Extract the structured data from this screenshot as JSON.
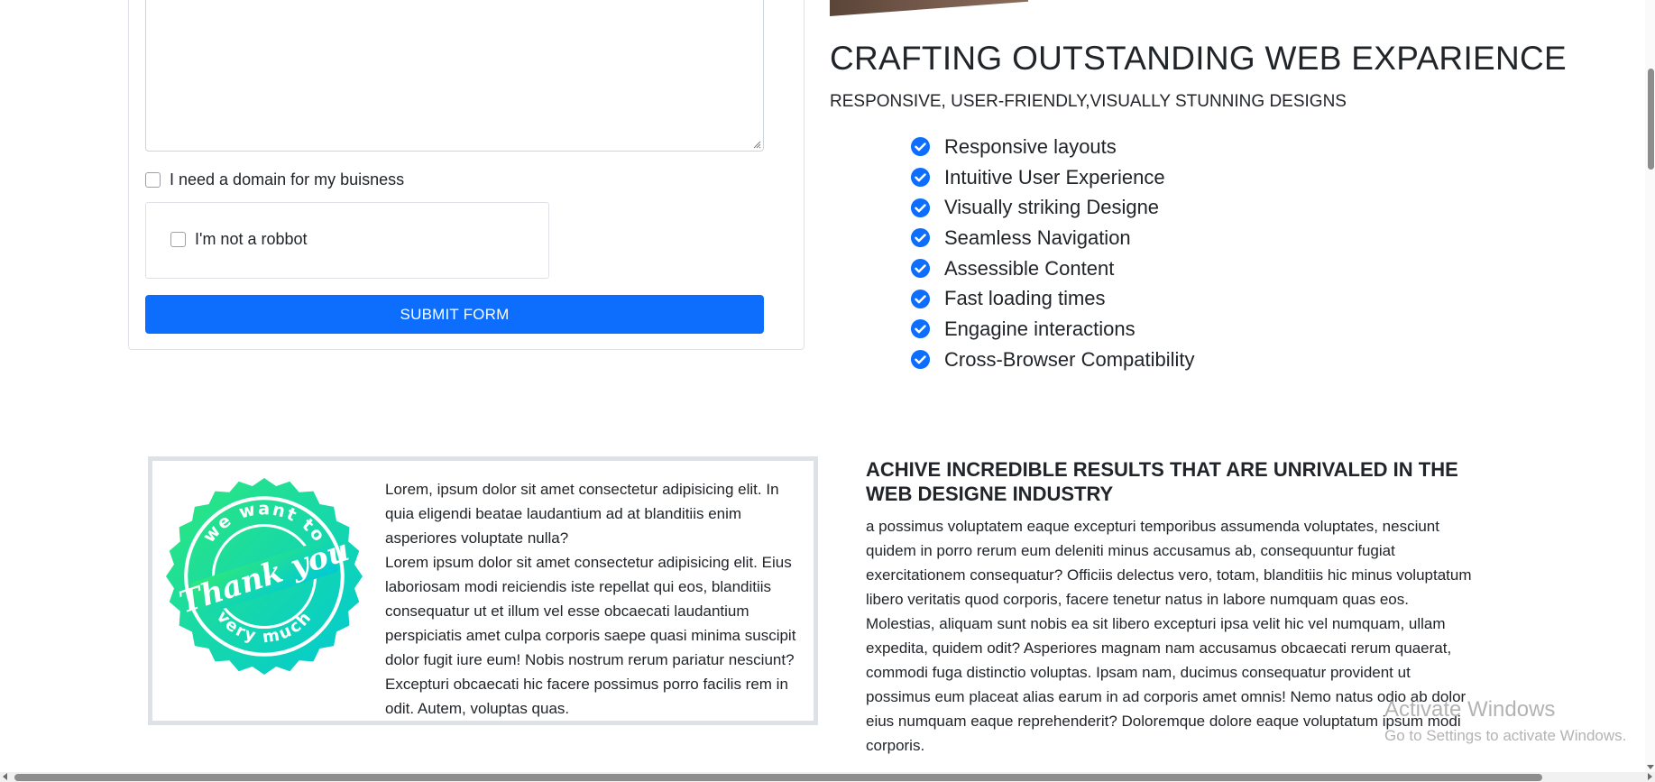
{
  "form": {
    "domain_checkbox_label": "I need a domain for my buisness",
    "captcha_label": "I'm not a robbot",
    "submit_label": "SUBMIT FORM"
  },
  "hero": {
    "title": "CRAFTING OUTSTANDING WEB EXPARIENCE",
    "subtitle": "RESPONSIVE, USER-FRIENDLY,VISUALLY STUNNING DESIGNS",
    "features": [
      "Responsive layouts",
      "Intuitive User Experience",
      "Visually striking Designe",
      "Seamless Navigation",
      "Assessible Content",
      "Fast loading times",
      "Engagine interactions",
      "Cross-Browser Compatibility"
    ]
  },
  "thanks": {
    "badge_text_top": "we want to",
    "badge_text_main": "Thank you",
    "badge_text_bottom": "very much",
    "paragraph_1": "Lorem, ipsum dolor sit amet consectetur adipisicing elit. In quia eligendi beatae laudantium ad at blanditiis enim asperiores voluptate nulla?",
    "paragraph_2": "Lorem ipsum dolor sit amet consectetur adipisicing elit. Eius laboriosam modi reiciendis iste repellat qui eos, blanditiis consequatur ut et illum vel esse obcaecati laudantium perspiciatis amet culpa corporis saepe quasi minima suscipit dolor fugit iure eum! Nobis nostrum rerum pariatur nesciunt? Excepturi obcaecati hic facere possimus porro facilis rem in odit. Autem, voluptas quas."
  },
  "results": {
    "title": "ACHIVE INCREDIBLE RESULTS THAT ARE UNRIVALED IN THE WEB DESIGNE INDUSTRY",
    "body": "a possimus voluptatem eaque excepturi temporibus assumenda voluptates, nesciunt quidem in porro rerum eum deleniti minus accusamus ab, consequuntur fugiat exercitationem consequatur? Officiis delectus vero, totam, blanditiis hic minus voluptatum libero veritatis quod corporis, facere tenetur natus in labore numquam quas eos. Molestias, aliquam sunt nobis ea sit libero excepturi ipsa velit hic vel numquam, ullam expedita, quidem odit? Asperiores magnam nam accusamus obcaecati rerum quaerat, commodi fuga distinctio voluptas. Ipsam nam, ducimus consequatur provident ut possimus eum placeat alias earum in ad corporis amet omnis! Nemo natus odio ab dolor eius numquam eaque reprehenderit? Doloremque dolore eaque voluptatum ipsum modi corporis."
  },
  "watermark": {
    "title": "Activate Windows",
    "subtitle": "Go to Settings to activate Windows."
  },
  "colors": {
    "primary": "#0d6efd",
    "text": "#212529",
    "border": "#dee2e6",
    "badge_gradient_start": "#2ee87a",
    "badge_gradient_end": "#00c9d6"
  },
  "icons": {
    "feature_check": "check-circle-icon",
    "textarea_resize": "resize-handle-icon"
  }
}
